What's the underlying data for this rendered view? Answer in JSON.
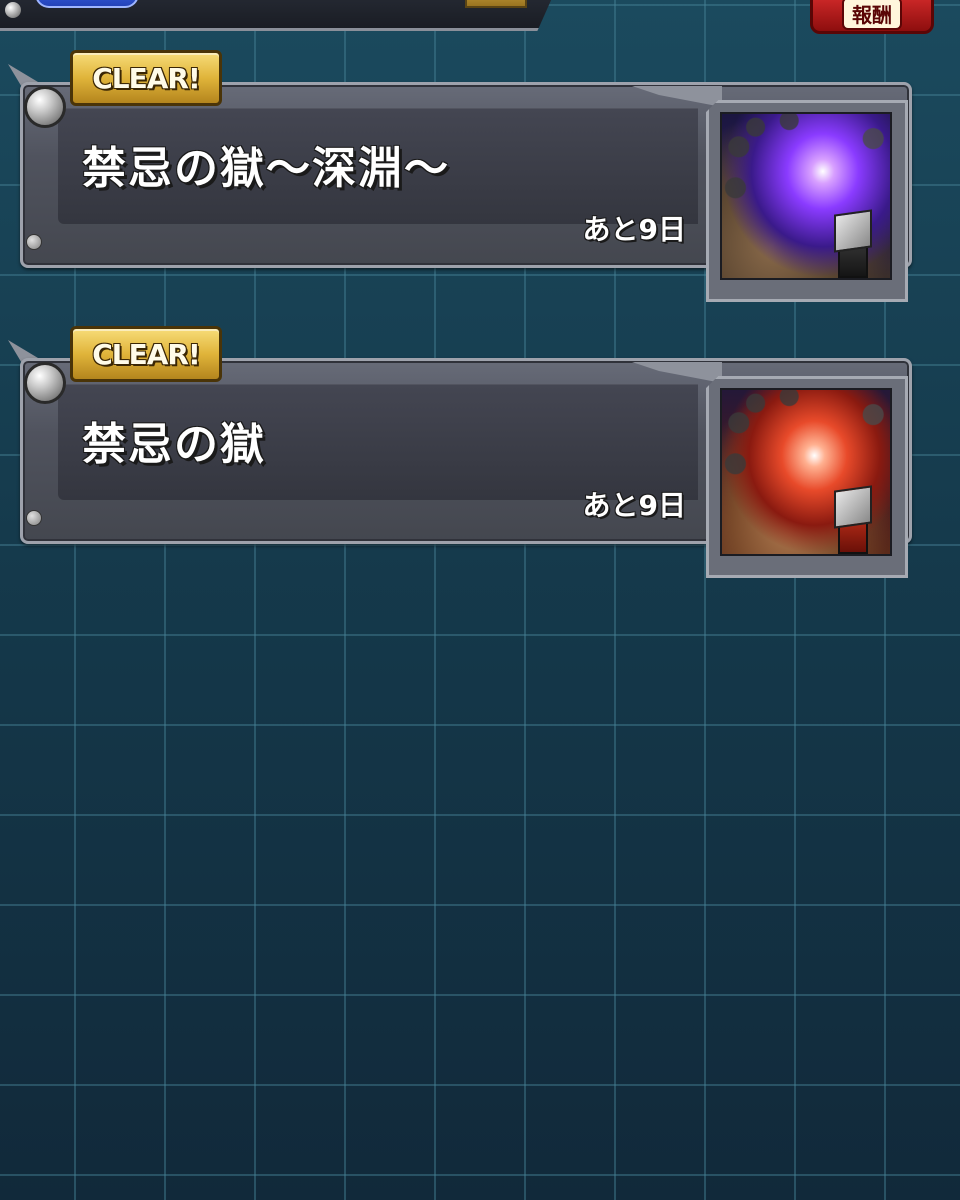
{
  "header": {
    "reward_label": "報酬"
  },
  "quests": [
    {
      "badge": "CLEAR!",
      "title": "禁忌の獄～深淵～",
      "remaining": "あと9日",
      "theme": "purple"
    },
    {
      "badge": "CLEAR!",
      "title": "禁忌の獄",
      "remaining": "あと9日",
      "theme": "red"
    }
  ],
  "colors": {
    "background": "#163a4c",
    "grid": "#46829a",
    "badge_gold": "#e0b43a",
    "reward_red": "#d22a2a"
  }
}
